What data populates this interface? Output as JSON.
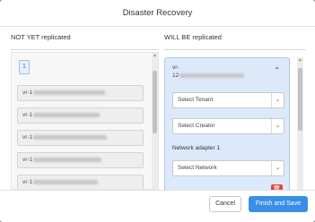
{
  "dialog": {
    "title": "Disaster Recovery"
  },
  "left_column": {
    "title": "NOT YET replicated",
    "page_chip": "1",
    "vms": [
      {
        "label": "vr-1"
      },
      {
        "label": "vr-1"
      },
      {
        "label": "vr-1"
      },
      {
        "label": "vr-1"
      },
      {
        "label": "vr-1"
      }
    ]
  },
  "right_column": {
    "title": "WILL BE replicated",
    "card": {
      "title_line1": "vr-",
      "title_line2": "12",
      "collapse_icon": "chevron-up-icon",
      "tenant_select": "Select Tenant",
      "creator_select": "Select Creator",
      "network_adapter_label": "Network adapter 1",
      "network_select": "Select Network",
      "delete_icon": "trash-icon"
    }
  },
  "footer": {
    "cancel_label": "Cancel",
    "save_label": "Finish and Save"
  },
  "colors": {
    "accent": "#3a8ee6",
    "danger": "#e4433b",
    "card_bg": "#dce9fb"
  }
}
